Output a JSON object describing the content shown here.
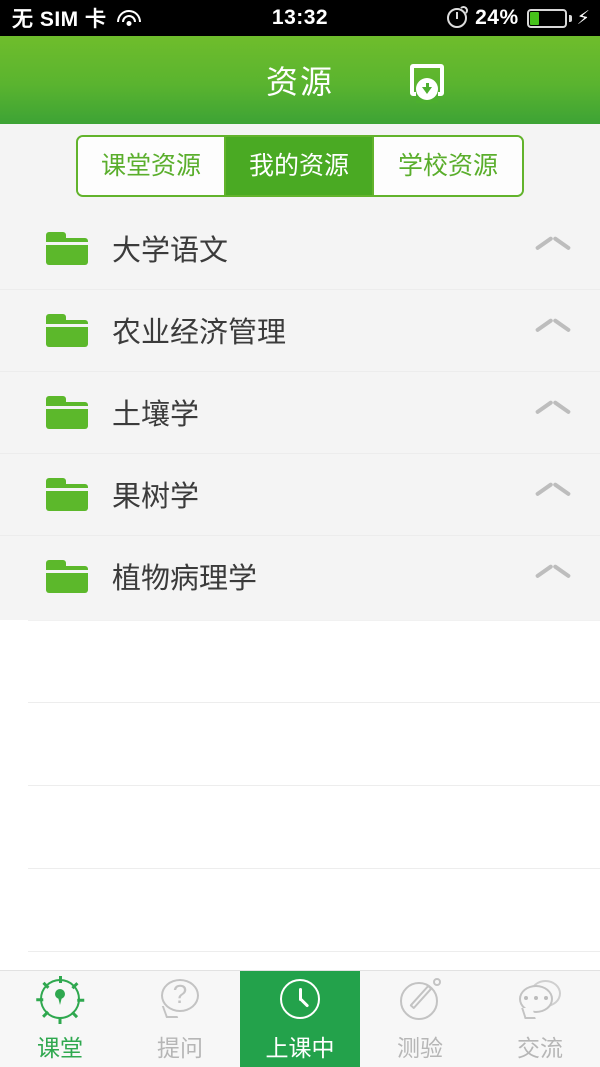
{
  "status_bar": {
    "carrier": "无 SIM 卡",
    "wifi_icon": "wifi-icon",
    "time": "13:32",
    "orientation_lock_icon": "rotation-lock-icon",
    "battery_percent": "24%",
    "battery_icon": "battery-icon",
    "charging_icon": "⚡"
  },
  "header": {
    "title": "资源",
    "download_icon": "download-icon"
  },
  "segmented": {
    "tabs": [
      {
        "label": "课堂资源",
        "active": false
      },
      {
        "label": "我的资源",
        "active": true
      },
      {
        "label": "学校资源",
        "active": false
      }
    ]
  },
  "list": {
    "items": [
      {
        "label": "大学语文",
        "folder_icon": "folder-icon",
        "chevron_icon": "chevron-up-icon"
      },
      {
        "label": "农业经济管理",
        "folder_icon": "folder-icon",
        "chevron_icon": "chevron-up-icon"
      },
      {
        "label": "土壤学",
        "folder_icon": "folder-icon",
        "chevron_icon": "chevron-up-icon"
      },
      {
        "label": "果树学",
        "folder_icon": "folder-icon",
        "chevron_icon": "chevron-up-icon"
      },
      {
        "label": "植物病理学",
        "folder_icon": "folder-icon",
        "chevron_icon": "chevron-up-icon"
      }
    ]
  },
  "tabbar": {
    "tabs": [
      {
        "label": "课堂",
        "icon": "compass-pin-icon",
        "state": "active"
      },
      {
        "label": "提问",
        "icon": "question-bubble-icon",
        "state": "inactive"
      },
      {
        "label": "上课中",
        "icon": "clock-icon",
        "state": "highlight"
      },
      {
        "label": "测验",
        "icon": "pencil-circle-icon",
        "state": "inactive"
      },
      {
        "label": "交流",
        "icon": "chat-bubbles-icon",
        "state": "inactive"
      }
    ]
  },
  "colors": {
    "brand_green": "#4daf2e",
    "header_gradient_top": "#6fbd2c",
    "header_gradient_bottom": "#3da335",
    "active_tab_green": "#4aaa23",
    "highlight_tab_green": "#23a24b",
    "list_background": "#f4f4f4",
    "folder_green": "#5cb82b",
    "inactive_gray": "#b6b6b6"
  }
}
